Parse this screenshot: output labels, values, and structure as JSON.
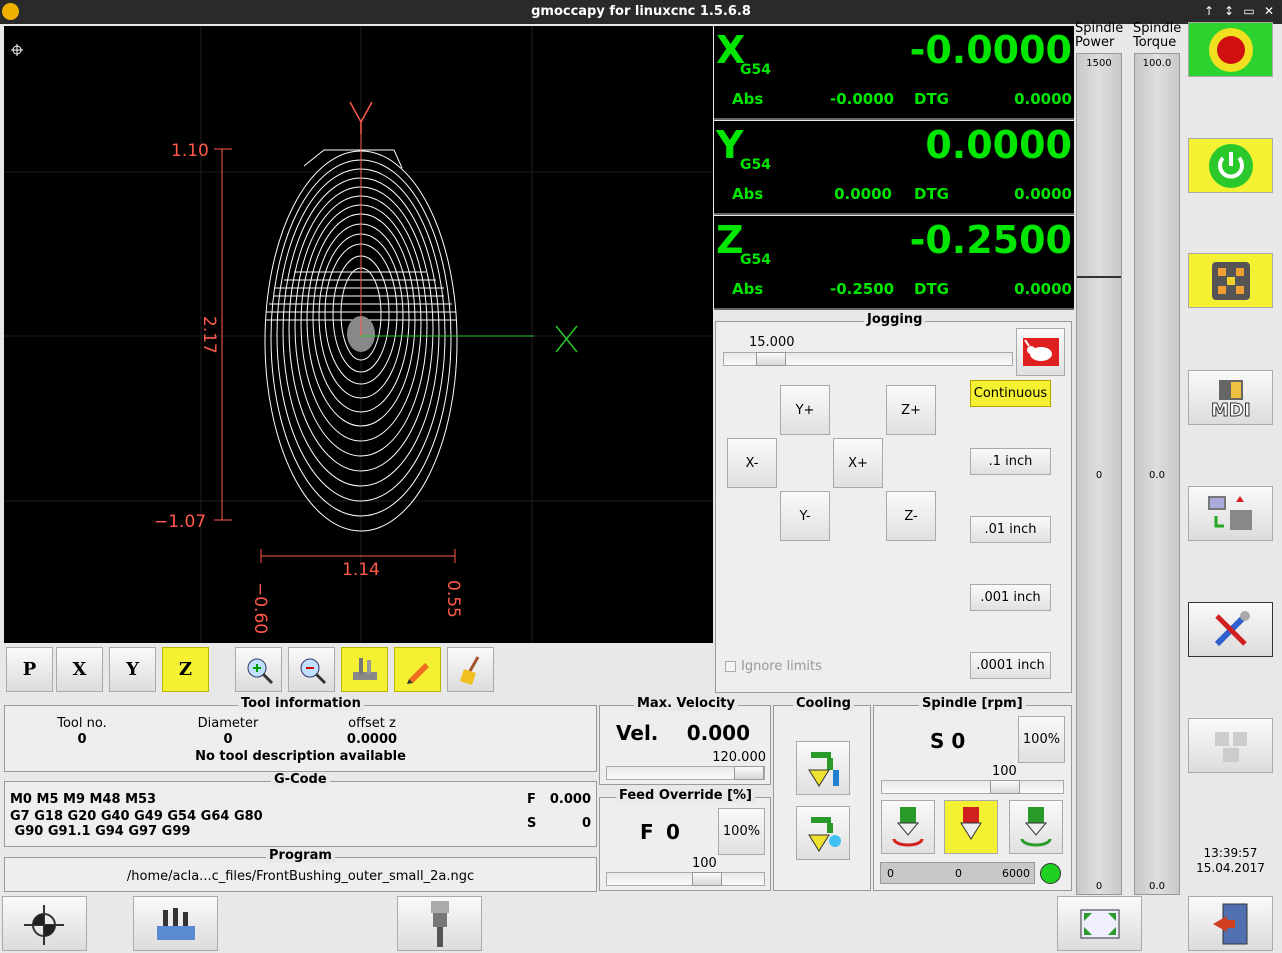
{
  "window": {
    "title": "gmoccapy for linuxcnc  1.5.6.8",
    "buttons": [
      "↑",
      "↕",
      "▭",
      "✕"
    ]
  },
  "preview": {
    "dims": {
      "y_top": "1.10",
      "y_mid": "2.17",
      "y_bottom": "−1.07",
      "x_mid": "1.14",
      "x_left": "−0.60",
      "x_right": "0.55"
    }
  },
  "view_buttons": [
    "P",
    "X",
    "Y",
    "Z"
  ],
  "dro": [
    {
      "axis": "X",
      "offset": "G54",
      "value": "-0.0000",
      "abs_label": "Abs",
      "abs": "-0.0000",
      "dtg_label": "DTG",
      "dtg": "0.0000"
    },
    {
      "axis": "Y",
      "offset": "G54",
      "value": "0.0000",
      "abs_label": "Abs",
      "abs": "0.0000",
      "dtg_label": "DTG",
      "dtg": "0.0000"
    },
    {
      "axis": "Z",
      "offset": "G54",
      "value": "-0.2500",
      "abs_label": "Abs",
      "abs": "-0.2500",
      "dtg_label": "DTG",
      "dtg": "0.0000"
    }
  ],
  "jogging": {
    "title": "Jogging",
    "speed": "15.000",
    "buttons": {
      "yplus": "Y+",
      "zplus": "Z+",
      "xminus": "X-",
      "xplus": "X+",
      "yminus": "Y-",
      "zminus": "Z-"
    },
    "increments": [
      "Continuous",
      ".1 inch",
      ".01 inch",
      ".001 inch",
      ".0001 inch"
    ],
    "ignore_limits": "Ignore limits"
  },
  "spindle_bars": {
    "power_label_1": "Spindle",
    "power_label_2": "Power",
    "power_max": "1500",
    "power_mid": "0",
    "power_min": "0",
    "torque_label_1": "Spindle",
    "torque_label_2": "Torque",
    "torque_max": "100.0",
    "torque_mid": "0.0",
    "torque_min": "0.0"
  },
  "tool_info": {
    "title": "Tool information",
    "tool_no_label": "Tool no.",
    "tool_no": "0",
    "diameter_label": "Diameter",
    "diameter": "0",
    "offset_label": "offset z",
    "offset": "0.0000",
    "description": "No tool description available"
  },
  "gcode": {
    "title": "G-Code",
    "line1": "M0 M5 M9 M48 M53",
    "line2": "G7 G18 G20 G40 G49 G54 G64 G80",
    "line3": " G90 G91.1 G94 G97 G99",
    "f_label": "F",
    "f_value": "0.000",
    "s_label": "S",
    "s_value": "0"
  },
  "program": {
    "title": "Program",
    "path": "/home/acla...c_files/FrontBushing_outer_small_2a.ngc"
  },
  "max_velocity": {
    "title": "Max. Velocity",
    "label": "Vel.",
    "value": "0.000",
    "max": "120.000"
  },
  "feed_override": {
    "title": "Feed Override [%]",
    "label": "F",
    "value": "0",
    "button": "100%",
    "scale": "100"
  },
  "cooling": {
    "title": "Cooling"
  },
  "spindle": {
    "title": "Spindle [rpm]",
    "label": "S 0",
    "button": "100%",
    "scale": "100",
    "range_min": "0",
    "range_val": "0",
    "range_max": "6000"
  },
  "clock": {
    "time": "13:39:57",
    "date": "15.04.2017"
  },
  "colors": {
    "dro_green": "#00e600",
    "accent_yellow": "#f4f032",
    "dim_red": "#ff5a4a"
  }
}
